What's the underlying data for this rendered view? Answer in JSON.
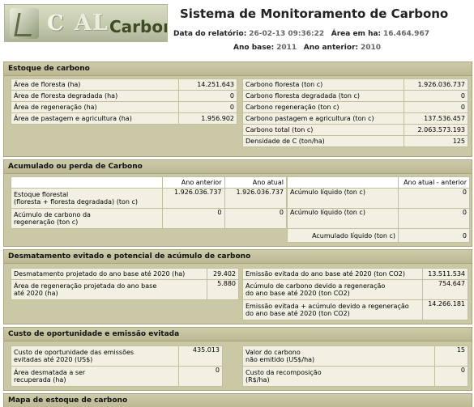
{
  "logo": {
    "text_part1": "C",
    "text_part2": "AL",
    "text_part3": "Carbono"
  },
  "title": "Sistema de Monitoramento de Carbono",
  "report": {
    "date_label": "Data do relatório:",
    "date_value": "26-02-13 09:36:22",
    "area_label": "Área em ha:",
    "area_value": "16.464.967",
    "base_year_label": "Ano base:",
    "base_year_value": "2011",
    "prev_year_label": "Ano anterior:",
    "prev_year_value": "2010"
  },
  "estoque": {
    "title": "Estoque de carbono",
    "left": [
      {
        "label": "Área de floresta (ha)",
        "value": "14.251.643"
      },
      {
        "label": "Área de floresta degradada (ha)",
        "value": "0"
      },
      {
        "label": "Área de regeneração (ha)",
        "value": "0"
      },
      {
        "label": "Área de pastagem e agricultura (ha)",
        "value": "1.956.902"
      }
    ],
    "right": [
      {
        "label": "Carbono floresta (ton c)",
        "value": "1.926.036.737"
      },
      {
        "label": "Carbono floresta degradada (ton c)",
        "value": "0"
      },
      {
        "label": "Carbono regeneração (ton c)",
        "value": "0"
      },
      {
        "label": "Carbono pastagem e agricultura (ton c)",
        "value": "137.536.457"
      },
      {
        "label": "Carbono total (ton c)",
        "value": "2.063.573.193"
      },
      {
        "label": "Densidade de C (ton/ha)",
        "value": "125"
      }
    ]
  },
  "acumulado": {
    "title": "Acumulado ou perda de Carbono",
    "col_prev": "Ano anterior",
    "col_curr": "Ano atual",
    "col_diff": "Ano atual - anterior",
    "row1_label_a": "Estoque florestal",
    "row1_label_b": "(floresta + floresta degradada) (ton c)",
    "row1_prev": "1.926.036.737",
    "row1_curr": "1.926.036.737",
    "row2_label_a": "Acúmulo de carbono da",
    "row2_label_b": "regeneração (ton c)",
    "row2_prev": "0",
    "row2_curr": "0",
    "right": [
      {
        "label": "Acúmulo líquido (ton c)",
        "value": "0"
      },
      {
        "label": "Acúmulo líquido (ton c)",
        "value": "0"
      },
      {
        "label": "Acumulado líquido (ton c)",
        "value": "0"
      }
    ]
  },
  "desmatamento": {
    "title": "Desmatamento evitado e potencial de acúmulo de carbono",
    "l1_label": "Desmatamento projetado do ano base até 2020 (ha)",
    "l1_value": "29.402",
    "l2_label_a": "Área de regeneração projetada do ano base",
    "l2_label_b": "até 2020 (ha)",
    "l2_value": "5.880",
    "r1_label": "Emissão evitada do ano base até 2020 (ton CO2)",
    "r1_value": "13.511.534",
    "r2_label_a": "Acúmulo de carbono devido a regeneração",
    "r2_label_b": "do ano base até 2020 (ton CO2)",
    "r2_value": "754.647",
    "r3_label_a": "Emissão evitada + acúmulo devido a regeneração",
    "r3_label_b": "do ano base até 2020 (ton CO2)",
    "r3_value": "14.266.181"
  },
  "custo": {
    "title": "Custo de oportunidade e emissão evitada",
    "l1_label_a": "Custo de oportunidade das emissões",
    "l1_label_b": "evitadas até 2020 (US$)",
    "l1_value": "435.013",
    "l2_label_a": "Área desmatada a ser",
    "l2_label_b": "recuperada (ha)",
    "l2_value": "0",
    "r1_label_a": "Valor do carbono",
    "r1_label_b": "não emitido (US$/ha)",
    "r1_value": "15",
    "r2_label_a": "Custo da recomposição",
    "r2_label_b": "(R$/ha)",
    "r2_value": "0"
  },
  "mapa": {
    "title": "Mapa de estoque de carbono"
  }
}
